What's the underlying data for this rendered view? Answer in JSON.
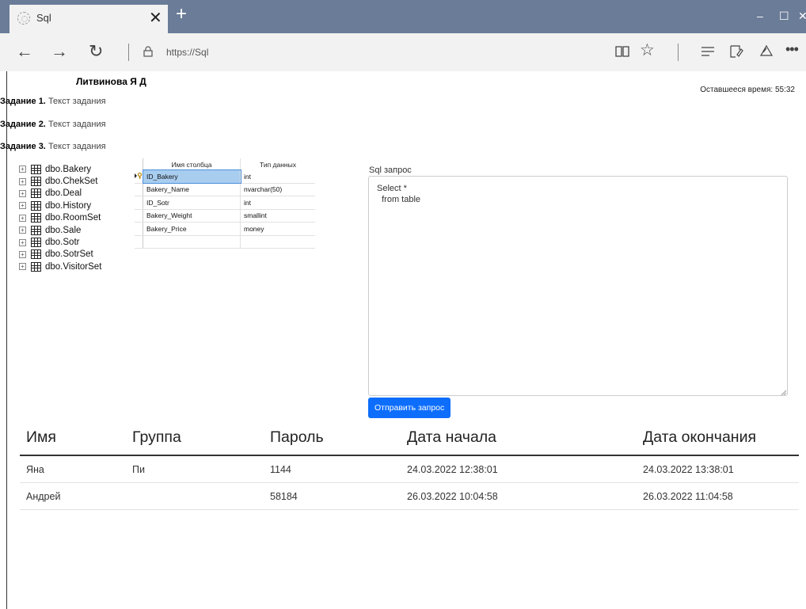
{
  "browser": {
    "tab_title": "Sql",
    "tab_close": "✕",
    "new_tab": "+",
    "url": "https://Sql",
    "window_controls": {
      "minimize": "–",
      "maximize": "☐",
      "close": "✕"
    }
  },
  "page": {
    "student_name": "Литвинова Я Д",
    "timer_label": "Оставшееся время:",
    "timer_value": "55:32",
    "tasks": [
      {
        "label": "Задание 1.",
        "text": "Текст задания"
      },
      {
        "label": "Задание 2.",
        "text": "Текст задания"
      },
      {
        "label": "Задание 3.",
        "text": "Текст задания"
      }
    ],
    "tree_items": [
      "dbo.Bakery",
      "dbo.ChekSet",
      "dbo.Deal",
      "dbo.History",
      "dbo.RoomSet",
      "dbo.Sale",
      "dbo.Sotr",
      "dbo.SotrSet",
      "dbo.VisitorSet"
    ],
    "column_grid": {
      "headers": [
        "Имя столбца",
        "Тип данных"
      ],
      "rows": [
        {
          "name": "ID_Bakery",
          "type": "int",
          "primary_key": true
        },
        {
          "name": "Bakery_Name",
          "type": "nvarchar(50)"
        },
        {
          "name": "ID_Sotr",
          "type": "int"
        },
        {
          "name": "Bakery_Weight",
          "type": "smallint"
        },
        {
          "name": "Bakery_Price",
          "type": "money"
        },
        {
          "name": "",
          "type": ""
        }
      ]
    },
    "sql": {
      "label": "Sql запрос",
      "query": "Select *\n  from table",
      "submit_label": "Отправить запрос"
    },
    "results": {
      "headers": [
        "Имя",
        "Группа",
        "Пароль",
        "Дата начала",
        "Дата окончания"
      ],
      "rows": [
        [
          "Яна",
          "Пи",
          "1144",
          "24.03.2022 12:38:01",
          "24.03.2022 13:38:01"
        ],
        [
          "Андрей",
          "",
          "58184",
          "26.03.2022 10:04:58",
          "26.03.2022 11:04:58"
        ]
      ]
    }
  },
  "colors": {
    "titlebar": "#6a7c98",
    "accent_button": "#0d6efd",
    "selected_cell": "#a8cdef"
  }
}
